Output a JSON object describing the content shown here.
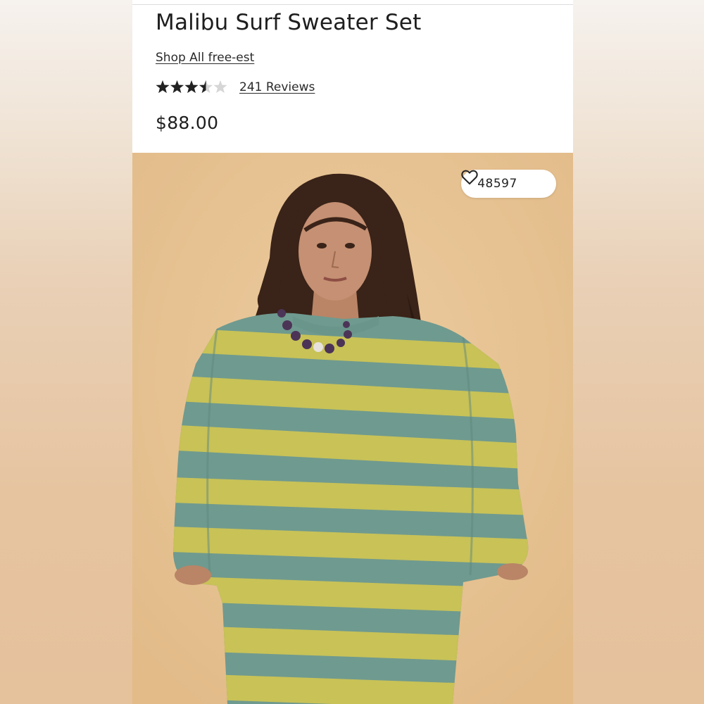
{
  "product": {
    "title": "Malibu Surf Sweater Set",
    "shop_link": "Shop All free-est",
    "rating": 3.5,
    "rating_max": 5,
    "reviews_label": "241 Reviews",
    "price": "$88.00"
  },
  "image": {
    "favorites_count": "48597",
    "favorite_icon": "heart-outline-icon",
    "description_colors": {
      "backdrop": "#e8c597",
      "stripe_green": "#6f9a8f",
      "stripe_yellow": "#c8c257"
    }
  }
}
